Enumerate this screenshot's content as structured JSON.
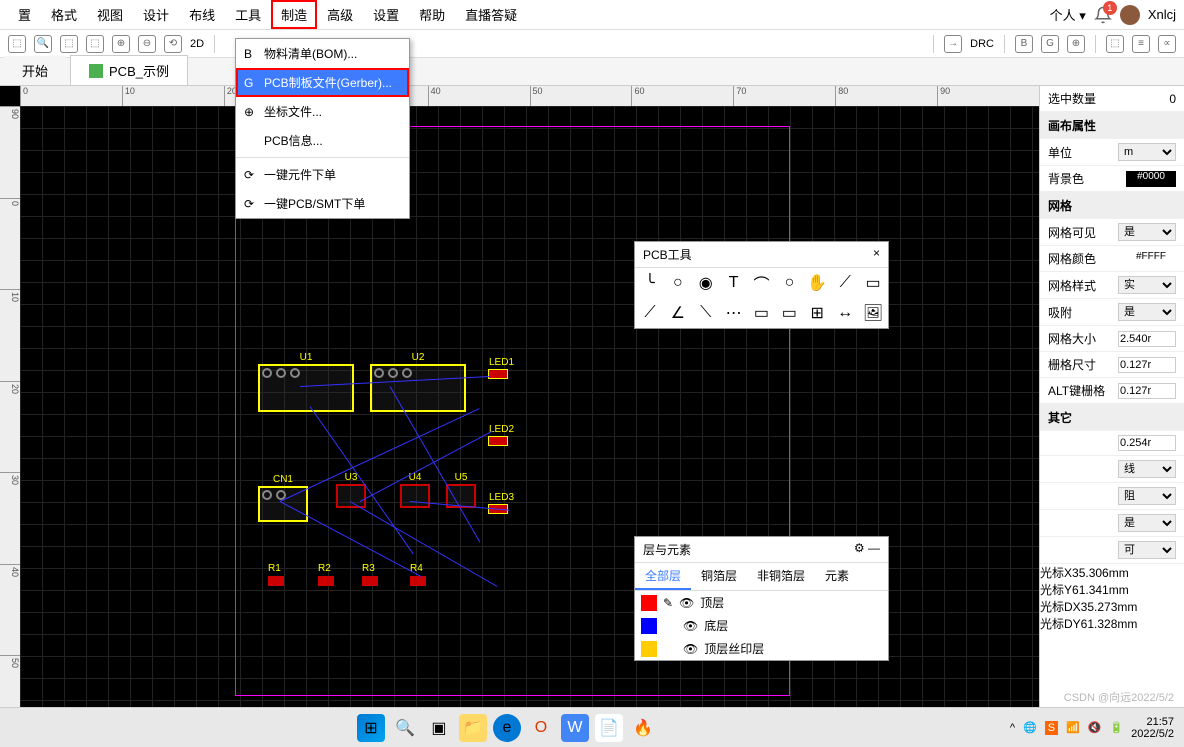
{
  "menubar": {
    "items": [
      "置",
      "格式",
      "视图",
      "设计",
      "布线",
      "工具",
      "制造",
      "高级",
      "设置",
      "帮助",
      "直播答疑"
    ],
    "highlighted_index": 6,
    "user_label": "个人 ▾",
    "notification_count": "1",
    "username": "Xnlcj"
  },
  "dropdown": {
    "items": [
      {
        "icon": "B",
        "label": "物料清单(BOM)..."
      },
      {
        "icon": "G",
        "label": "PCB制板文件(Gerber)...",
        "selected": true
      },
      {
        "icon": "⊕",
        "label": "坐标文件..."
      },
      {
        "icon": "",
        "label": "PCB信息..."
      },
      {
        "icon": "⟳",
        "label": "一键元件下单",
        "sep_before": true
      },
      {
        "icon": "⟳",
        "label": "一键PCB/SMT下单"
      }
    ]
  },
  "tabs": {
    "home": "开始",
    "active": "PCB_示例"
  },
  "ruler_h": [
    "0",
    "10",
    "20",
    "30",
    "40",
    "50",
    "60",
    "70",
    "80",
    "90"
  ],
  "ruler_v": [
    "90",
    "0",
    "10",
    "20",
    "30",
    "40",
    "50"
  ],
  "pcb_tools": {
    "title": "PCB工具",
    "close": "×"
  },
  "layers": {
    "title": "层与元素",
    "close": "—",
    "tabs": [
      "全部层",
      "铜箔层",
      "非铜箔层",
      "元素"
    ],
    "active_tab": 0,
    "rows": [
      {
        "color": "#ff0000",
        "name": "顶层",
        "editing": true
      },
      {
        "color": "#0000ff",
        "name": "底层"
      },
      {
        "color": "#ffcc00",
        "name": "顶层丝印层"
      }
    ]
  },
  "sidepanel": {
    "selected_label": "选中数量",
    "selected_count": "0",
    "sections": [
      {
        "title": "画布属性",
        "rows": [
          {
            "label": "单位",
            "type": "select",
            "value": "m"
          },
          {
            "label": "背景色",
            "type": "color",
            "value": "#0000"
          }
        ]
      },
      {
        "title": "网格",
        "rows": [
          {
            "label": "网格可见",
            "type": "select",
            "value": "是"
          },
          {
            "label": "网格颜色",
            "type": "color",
            "value": "#FFFF"
          },
          {
            "label": "网格样式",
            "type": "select",
            "value": "实"
          },
          {
            "label": "吸附",
            "type": "select",
            "value": "是"
          },
          {
            "label": "网格大小",
            "type": "input",
            "value": "2.540r"
          },
          {
            "label": "栅格尺寸",
            "type": "input",
            "value": "0.127r"
          },
          {
            "label": "ALT键栅格",
            "type": "input",
            "value": "0.127r"
          }
        ]
      },
      {
        "title": "其它",
        "rows": [
          {
            "label": "",
            "type": "input",
            "value": "0.254r"
          },
          {
            "label": "",
            "type": "select",
            "value": "线"
          },
          {
            "label": "",
            "type": "select",
            "value": "阻"
          },
          {
            "label": "",
            "type": "select",
            "value": "是"
          },
          {
            "label": "",
            "type": "select",
            "value": "可"
          }
        ]
      }
    ]
  },
  "cursor": {
    "rows": [
      {
        "label": "光标X",
        "value": "35.306mm"
      },
      {
        "label": "光标Y",
        "value": "61.341mm"
      },
      {
        "label": "光标DX",
        "value": "35.273mm"
      },
      {
        "label": "光标DY",
        "value": "61.328mm"
      }
    ]
  },
  "components": {
    "u1": "U1",
    "u2": "U2",
    "u3": "U3",
    "u4": "U4",
    "u5": "U5",
    "cn1": "CN1",
    "led1": "LED1",
    "led2": "LED2",
    "led3": "LED3",
    "r1": "R1",
    "r2": "R2",
    "r3": "R3",
    "r4": "R4"
  },
  "toolbar_drc": "DRC",
  "taskbar": {
    "time": "21:57",
    "date": "2022/5/2"
  },
  "watermark": "CSDN @向远2022/5/2"
}
